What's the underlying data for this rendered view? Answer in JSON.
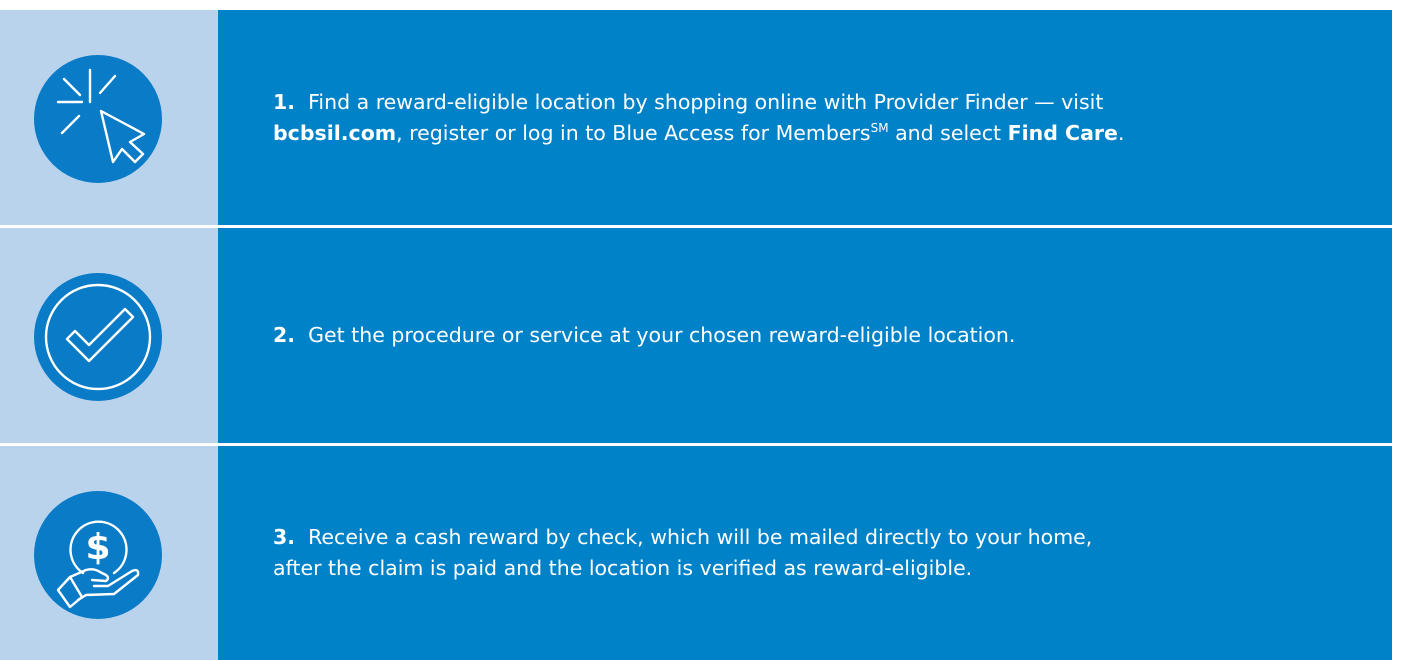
{
  "steps": [
    {
      "icon": "cursor-click-icon",
      "number": "1.",
      "text_1": "Find a reward-eligible location by shopping online with Provider Finder — visit",
      "link_1": "bcbsil.com",
      "text_2": ", register or log in to Blue Access for Members",
      "superscript": "SM",
      "text_3": " and select ",
      "link_2": "Find Care",
      "text_4": "."
    },
    {
      "icon": "checkmark-circle-icon",
      "number": "2.",
      "text": "Get the procedure or service at your chosen reward-eligible location."
    },
    {
      "icon": "dollar-hand-icon",
      "number": "3.",
      "line_1": "Receive a cash reward by check, which will be mailed directly to your home,",
      "line_2": "after the claim is paid and the location is verified as reward-eligible."
    }
  ],
  "colors": {
    "icon_panel": "#bad3ec",
    "text_panel": "#0082c8",
    "icon_circle": "#0a7bc7",
    "text": "#ffffff"
  }
}
